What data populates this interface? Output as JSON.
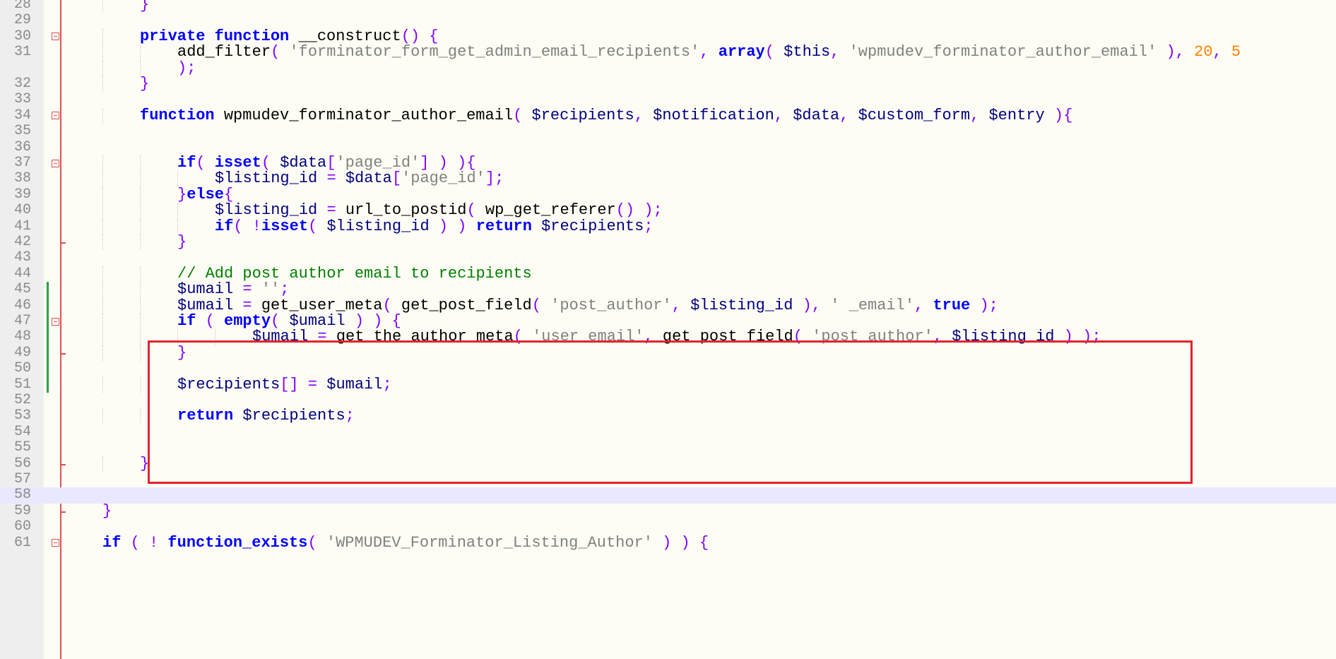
{
  "editor": {
    "language": "php",
    "current_line": 58,
    "highlight_lines": [
      45,
      51
    ],
    "lines": [
      {
        "no": "28",
        "indent": 2,
        "tokens": [
          [
            "op",
            "}"
          ]
        ]
      },
      {
        "no": "29",
        "indent": 0,
        "tokens": []
      },
      {
        "no": "30",
        "indent": 2,
        "fold": "open",
        "tokens": [
          [
            "kw",
            "private"
          ],
          [
            "plain",
            " "
          ],
          [
            "kw",
            "function"
          ],
          [
            "plain",
            " "
          ],
          [
            "plain",
            "__construct"
          ],
          [
            "op",
            "() {"
          ]
        ]
      },
      {
        "no": "31",
        "indent": 3,
        "tokens": [
          [
            "plain",
            "add_filter"
          ],
          [
            "op",
            "( "
          ],
          [
            "str",
            "'forminator_form_get_admin_email_recipients'"
          ],
          [
            "op",
            ", "
          ],
          [
            "kw",
            "array"
          ],
          [
            "op",
            "( "
          ],
          [
            "var",
            "$this"
          ],
          [
            "op",
            ", "
          ],
          [
            "str",
            "'wpmudev_forminator_author_email'"
          ],
          [
            "op",
            " ), "
          ],
          [
            "num",
            "20"
          ],
          [
            "op",
            ", "
          ],
          [
            "num",
            "5"
          ]
        ]
      },
      {
        "no": "",
        "indent": 3,
        "wrap": true,
        "tokens": [
          [
            "op",
            ");"
          ]
        ]
      },
      {
        "no": "32",
        "indent": 2,
        "tokens": [
          [
            "op",
            "}"
          ]
        ]
      },
      {
        "no": "33",
        "indent": 0,
        "tokens": []
      },
      {
        "no": "34",
        "indent": 2,
        "fold": "open",
        "tokens": [
          [
            "kw",
            "function"
          ],
          [
            "plain",
            " "
          ],
          [
            "plain",
            "wpmudev_forminator_author_email"
          ],
          [
            "op",
            "( "
          ],
          [
            "var",
            "$recipients"
          ],
          [
            "op",
            ", "
          ],
          [
            "var",
            "$notification"
          ],
          [
            "op",
            ", "
          ],
          [
            "var",
            "$data"
          ],
          [
            "op",
            ", "
          ],
          [
            "var",
            "$custom_form"
          ],
          [
            "op",
            ", "
          ],
          [
            "var",
            "$entry"
          ],
          [
            "op",
            " ){"
          ]
        ]
      },
      {
        "no": "35",
        "indent": 0,
        "tokens": []
      },
      {
        "no": "36",
        "indent": 0,
        "tokens": []
      },
      {
        "no": "37",
        "indent": 3,
        "fold": "open",
        "tokens": [
          [
            "kw",
            "if"
          ],
          [
            "op",
            "( "
          ],
          [
            "kw",
            "isset"
          ],
          [
            "op",
            "( "
          ],
          [
            "var",
            "$data"
          ],
          [
            "op",
            "["
          ],
          [
            "str",
            "'page_id'"
          ],
          [
            "op",
            "] ) ){"
          ]
        ]
      },
      {
        "no": "38",
        "indent": 4,
        "tokens": [
          [
            "var",
            "$listing_id"
          ],
          [
            "plain",
            " "
          ],
          [
            "op",
            "="
          ],
          [
            "plain",
            " "
          ],
          [
            "var",
            "$data"
          ],
          [
            "op",
            "["
          ],
          [
            "str",
            "'page_id'"
          ],
          [
            "op",
            "];"
          ]
        ]
      },
      {
        "no": "39",
        "indent": 3,
        "tokens": [
          [
            "op",
            "}"
          ],
          [
            "kw",
            "else"
          ],
          [
            "op",
            "{"
          ]
        ]
      },
      {
        "no": "40",
        "indent": 4,
        "tokens": [
          [
            "var",
            "$listing_id"
          ],
          [
            "plain",
            " "
          ],
          [
            "op",
            "="
          ],
          [
            "plain",
            " "
          ],
          [
            "plain",
            "url_to_postid"
          ],
          [
            "op",
            "( "
          ],
          [
            "plain",
            "wp_get_referer"
          ],
          [
            "op",
            "() );"
          ]
        ]
      },
      {
        "no": "41",
        "indent": 4,
        "tokens": [
          [
            "kw",
            "if"
          ],
          [
            "op",
            "( !"
          ],
          [
            "kw",
            "isset"
          ],
          [
            "op",
            "( "
          ],
          [
            "var",
            "$listing_id"
          ],
          [
            "op",
            " ) ) "
          ],
          [
            "kw",
            "return"
          ],
          [
            "plain",
            " "
          ],
          [
            "var",
            "$recipients"
          ],
          [
            "op",
            ";"
          ]
        ]
      },
      {
        "no": "42",
        "indent": 3,
        "fold": "end",
        "tokens": [
          [
            "op",
            "}"
          ]
        ]
      },
      {
        "no": "43",
        "indent": 0,
        "tokens": []
      },
      {
        "no": "44",
        "indent": 3,
        "tokens": [
          [
            "cmt",
            "// Add post author email to recipients"
          ]
        ]
      },
      {
        "no": "45",
        "indent": 3,
        "changed": true,
        "tokens": [
          [
            "var",
            "$umail"
          ],
          [
            "plain",
            " "
          ],
          [
            "op",
            "="
          ],
          [
            "plain",
            " "
          ],
          [
            "str",
            "''"
          ],
          [
            "op",
            ";"
          ]
        ]
      },
      {
        "no": "46",
        "indent": 3,
        "changed": true,
        "tokens": [
          [
            "var",
            "$umail"
          ],
          [
            "plain",
            " "
          ],
          [
            "op",
            "="
          ],
          [
            "plain",
            " "
          ],
          [
            "plain",
            "get_user_meta"
          ],
          [
            "op",
            "( "
          ],
          [
            "plain",
            "get_post_field"
          ],
          [
            "op",
            "( "
          ],
          [
            "str",
            "'post_author'"
          ],
          [
            "op",
            ", "
          ],
          [
            "var",
            "$listing_id"
          ],
          [
            "op",
            " ), "
          ],
          [
            "str",
            "' _email'"
          ],
          [
            "op",
            ", "
          ],
          [
            "kw",
            "true"
          ],
          [
            "op",
            " );"
          ]
        ]
      },
      {
        "no": "47",
        "indent": 3,
        "changed": true,
        "fold": "open",
        "tokens": [
          [
            "kw",
            "if"
          ],
          [
            "plain",
            " "
          ],
          [
            "op",
            "( "
          ],
          [
            "kw",
            "empty"
          ],
          [
            "op",
            "( "
          ],
          [
            "var",
            "$umail"
          ],
          [
            "op",
            " ) ) {"
          ]
        ]
      },
      {
        "no": "48",
        "indent": 5,
        "changed": true,
        "tokens": [
          [
            "var",
            "$umail"
          ],
          [
            "plain",
            " "
          ],
          [
            "op",
            "="
          ],
          [
            "plain",
            " "
          ],
          [
            "plain",
            "get_the_author_meta"
          ],
          [
            "op",
            "( "
          ],
          [
            "str",
            "'user_email'"
          ],
          [
            "op",
            ", "
          ],
          [
            "plain",
            "get_post_field"
          ],
          [
            "op",
            "( "
          ],
          [
            "str",
            "'post_author'"
          ],
          [
            "op",
            ", "
          ],
          [
            "var",
            "$listing_id"
          ],
          [
            "op",
            " ) );"
          ]
        ]
      },
      {
        "no": "49",
        "indent": 3,
        "changed": true,
        "fold": "end",
        "tokens": [
          [
            "op",
            "}"
          ]
        ]
      },
      {
        "no": "50",
        "indent": 0,
        "changed": true,
        "tokens": []
      },
      {
        "no": "51",
        "indent": 3,
        "changed": true,
        "tokens": [
          [
            "var",
            "$recipients"
          ],
          [
            "op",
            "[]"
          ],
          [
            "plain",
            " "
          ],
          [
            "op",
            "="
          ],
          [
            "plain",
            " "
          ],
          [
            "var",
            "$umail"
          ],
          [
            "op",
            ";"
          ]
        ]
      },
      {
        "no": "52",
        "indent": 0,
        "tokens": []
      },
      {
        "no": "53",
        "indent": 3,
        "tokens": [
          [
            "kw",
            "return"
          ],
          [
            "plain",
            " "
          ],
          [
            "var",
            "$recipients"
          ],
          [
            "op",
            ";"
          ]
        ]
      },
      {
        "no": "54",
        "indent": 0,
        "tokens": []
      },
      {
        "no": "55",
        "indent": 0,
        "tokens": []
      },
      {
        "no": "56",
        "indent": 2,
        "fold": "end",
        "tokens": [
          [
            "op",
            "}"
          ]
        ]
      },
      {
        "no": "57",
        "indent": 0,
        "tokens": []
      },
      {
        "no": "58",
        "indent": 0,
        "current": true,
        "tokens": []
      },
      {
        "no": "59",
        "indent": 1,
        "fold": "end",
        "tokens": [
          [
            "op",
            "}"
          ]
        ]
      },
      {
        "no": "60",
        "indent": 0,
        "tokens": []
      },
      {
        "no": "61",
        "indent": 1,
        "fold": "open",
        "tokens": [
          [
            "kw",
            "if"
          ],
          [
            "plain",
            " "
          ],
          [
            "op",
            "( ! "
          ],
          [
            "kw",
            "function_exists"
          ],
          [
            "op",
            "( "
          ],
          [
            "str",
            "'WPMUDEV_Forminator_Listing_Author'"
          ],
          [
            "op",
            " ) ) {"
          ]
        ]
      }
    ]
  },
  "colors": {
    "keyword": "#0000FF",
    "operator": "#8000FF",
    "string": "#808080",
    "number": "#FF8000",
    "variable": "#000080",
    "comment": "#008000",
    "highlight_box": "#E1242B",
    "change_bar": "#2EA043",
    "current_line_bg": "#E8E8FF"
  }
}
